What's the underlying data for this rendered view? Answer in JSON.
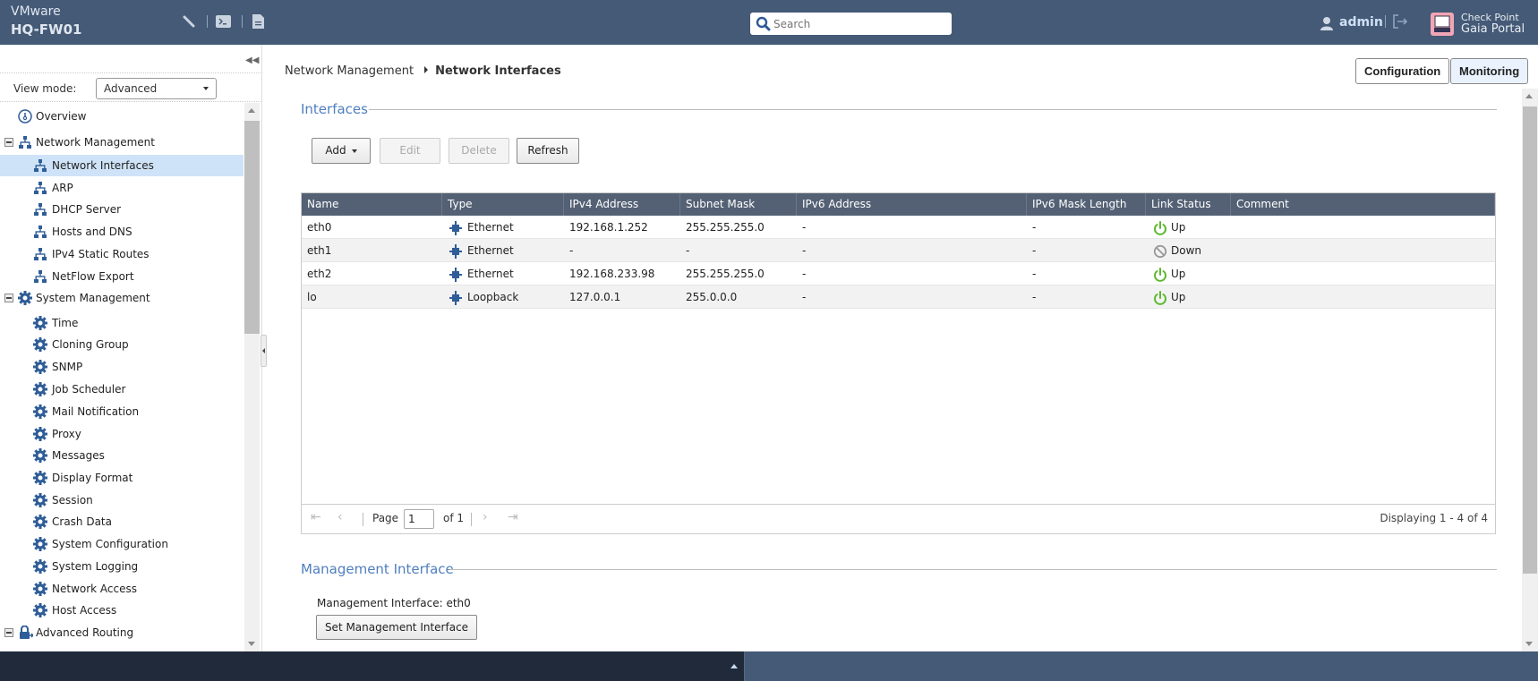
{
  "header": {
    "vendor": "VMware",
    "hostname": "HQ-FW01",
    "toolbar_icons": [
      "wrench-icon",
      "terminal-icon",
      "document-icon"
    ],
    "search_placeholder": "Search",
    "user": "admin",
    "logo_line1": "Check Point",
    "logo_line2": "Gaia Portal"
  },
  "sidebar": {
    "view_mode_label": "View mode:",
    "view_mode_value": "Advanced",
    "items": [
      {
        "label": "Overview",
        "level": 0,
        "icon": "overview-icon",
        "expander": false
      },
      {
        "label": "Network Management",
        "level": 0,
        "icon": "network-icon",
        "expander": true
      },
      {
        "label": "Network Interfaces",
        "level": 1,
        "icon": "network-icon",
        "selected": true
      },
      {
        "label": "ARP",
        "level": 1,
        "icon": "network-icon"
      },
      {
        "label": "DHCP Server",
        "level": 1,
        "icon": "network-icon"
      },
      {
        "label": "Hosts and DNS",
        "level": 1,
        "icon": "network-icon"
      },
      {
        "label": "IPv4 Static Routes",
        "level": 1,
        "icon": "network-icon"
      },
      {
        "label": "NetFlow Export",
        "level": 1,
        "icon": "network-icon"
      },
      {
        "label": "System Management",
        "level": 0,
        "icon": "gear-icon",
        "expander": true
      },
      {
        "label": "Time",
        "level": 1,
        "icon": "gear-icon"
      },
      {
        "label": "Cloning Group",
        "level": 1,
        "icon": "gear-icon"
      },
      {
        "label": "SNMP",
        "level": 1,
        "icon": "gear-icon"
      },
      {
        "label": "Job Scheduler",
        "level": 1,
        "icon": "gear-icon"
      },
      {
        "label": "Mail Notification",
        "level": 1,
        "icon": "gear-icon"
      },
      {
        "label": "Proxy",
        "level": 1,
        "icon": "gear-icon"
      },
      {
        "label": "Messages",
        "level": 1,
        "icon": "gear-icon"
      },
      {
        "label": "Display Format",
        "level": 1,
        "icon": "gear-icon"
      },
      {
        "label": "Session",
        "level": 1,
        "icon": "gear-icon"
      },
      {
        "label": "Crash Data",
        "level": 1,
        "icon": "gear-icon"
      },
      {
        "label": "System Configuration",
        "level": 1,
        "icon": "gear-icon"
      },
      {
        "label": "System Logging",
        "level": 1,
        "icon": "gear-icon"
      },
      {
        "label": "Network Access",
        "level": 1,
        "icon": "gear-icon"
      },
      {
        "label": "Host Access",
        "level": 1,
        "icon": "gear-icon"
      },
      {
        "label": "Advanced Routing",
        "level": 0,
        "icon": "lock-routing-icon",
        "expander": true
      }
    ]
  },
  "main": {
    "breadcrumb": {
      "parent": "Network Management",
      "current": "Network Interfaces"
    },
    "mode_buttons": {
      "configuration": "Configuration",
      "monitoring": "Monitoring",
      "active": "Monitoring"
    },
    "interfaces_section": "Interfaces",
    "actions": {
      "add": "Add",
      "edit": "Edit",
      "delete": "Delete",
      "refresh": "Refresh"
    },
    "table": {
      "columns": [
        "Name",
        "Type",
        "IPv4 Address",
        "Subnet Mask",
        "IPv6 Address",
        "IPv6 Mask Length",
        "Link Status",
        "Comment"
      ],
      "rows": [
        {
          "name": "eth0",
          "type": "Ethernet",
          "ipv4": "192.168.1.252",
          "mask": "255.255.255.0",
          "ipv6": "-",
          "ipv6_mask": "-",
          "status": "Up",
          "comment": ""
        },
        {
          "name": "eth1",
          "type": "Ethernet",
          "ipv4": "-",
          "mask": "-",
          "ipv6": "-",
          "ipv6_mask": "-",
          "status": "Down",
          "comment": ""
        },
        {
          "name": "eth2",
          "type": "Ethernet",
          "ipv4": "192.168.233.98",
          "mask": "255.255.255.0",
          "ipv6": "-",
          "ipv6_mask": "-",
          "status": "Up",
          "comment": ""
        },
        {
          "name": "lo",
          "type": "Loopback",
          "ipv4": "127.0.0.1",
          "mask": "255.0.0.0",
          "ipv6": "-",
          "ipv6_mask": "-",
          "status": "Up",
          "comment": ""
        }
      ]
    },
    "pager": {
      "page_label": "Page",
      "page": "1",
      "of_label": "of 1",
      "display": "Displaying 1 - 4 of 4"
    },
    "management_section": "Management Interface",
    "management_text": "Management Interface: eth0",
    "set_management_button": "Set Management Interface"
  },
  "colors": {
    "header_bg": "#445a76",
    "accent": "#4f7fbf",
    "status_up": "#5cb82e",
    "status_down": "#999999",
    "grid_header": "#546175"
  }
}
